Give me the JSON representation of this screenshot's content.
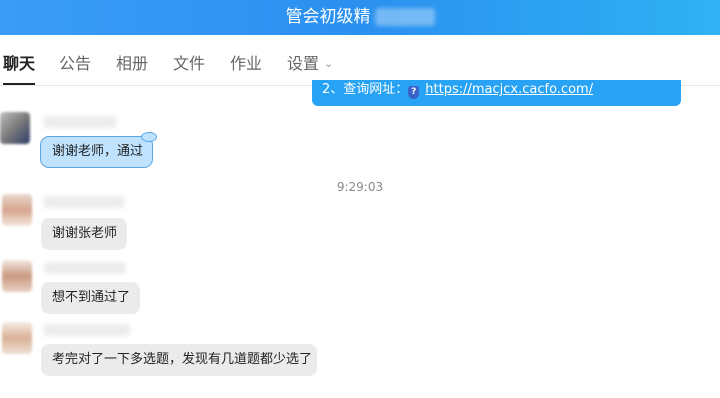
{
  "window": {
    "title": "管会初级精"
  },
  "tabs": [
    {
      "label": "聊天"
    },
    {
      "label": "公告"
    },
    {
      "label": "相册"
    },
    {
      "label": "文件"
    },
    {
      "label": "作业"
    },
    {
      "label": "设置"
    }
  ],
  "notice": {
    "prefix": "2、查询网址：",
    "link": "https://macjcx.cacfo.com/"
  },
  "messages": [
    {
      "text": "谢谢老师，通过",
      "style": "blue"
    },
    {
      "text": "谢谢张老师"
    },
    {
      "text": "想不到通过了"
    },
    {
      "text": "考完对了一下多选题，发现有几道题都少选了"
    }
  ],
  "timestamp": "9:29:03",
  "colors": {
    "header": "#2a90f0",
    "bubble_blue": "#bfe3ff",
    "bubble_gray": "#ebebeb"
  }
}
